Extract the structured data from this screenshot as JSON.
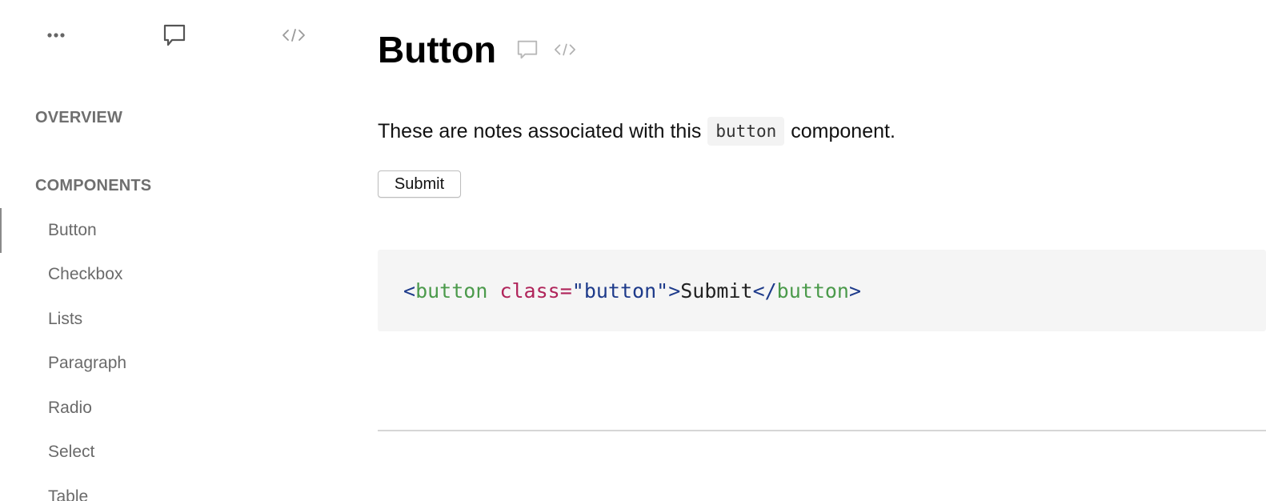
{
  "sidebar": {
    "toolbar": {
      "more_icon": "more-horizontal-icon",
      "comment_icon": "comment-icon",
      "code_icon": "code-icon"
    },
    "sections": {
      "overview": "OVERVIEW",
      "components": "COMPONENTS"
    },
    "items": [
      {
        "label": "Button",
        "active": true
      },
      {
        "label": "Checkbox",
        "active": false
      },
      {
        "label": "Lists",
        "active": false
      },
      {
        "label": "Paragraph",
        "active": false
      },
      {
        "label": "Radio",
        "active": false
      },
      {
        "label": "Select",
        "active": false
      },
      {
        "label": "Table",
        "active": false
      }
    ]
  },
  "main": {
    "title": "Button",
    "title_icons": [
      "comment-icon",
      "code-icon"
    ],
    "notes": {
      "before": "These are notes associated with this",
      "code": "button",
      "after": "component."
    },
    "demo_button_label": "Submit",
    "code_snippet": {
      "lt": "<",
      "tag": "button",
      "attr": "class",
      "eq": "=",
      "value": "\"button\"",
      "gt": ">",
      "text": "Submit",
      "close_open": "</",
      "close_tag": "button",
      "close_gt": ">"
    }
  },
  "colors": {
    "sidebar_text": "#6a6a6a",
    "code_bg": "#f5f5f5",
    "tag_green": "#4b9a4b",
    "attr_magenta": "#b0245a",
    "punct_blue": "#1d3a8a"
  }
}
